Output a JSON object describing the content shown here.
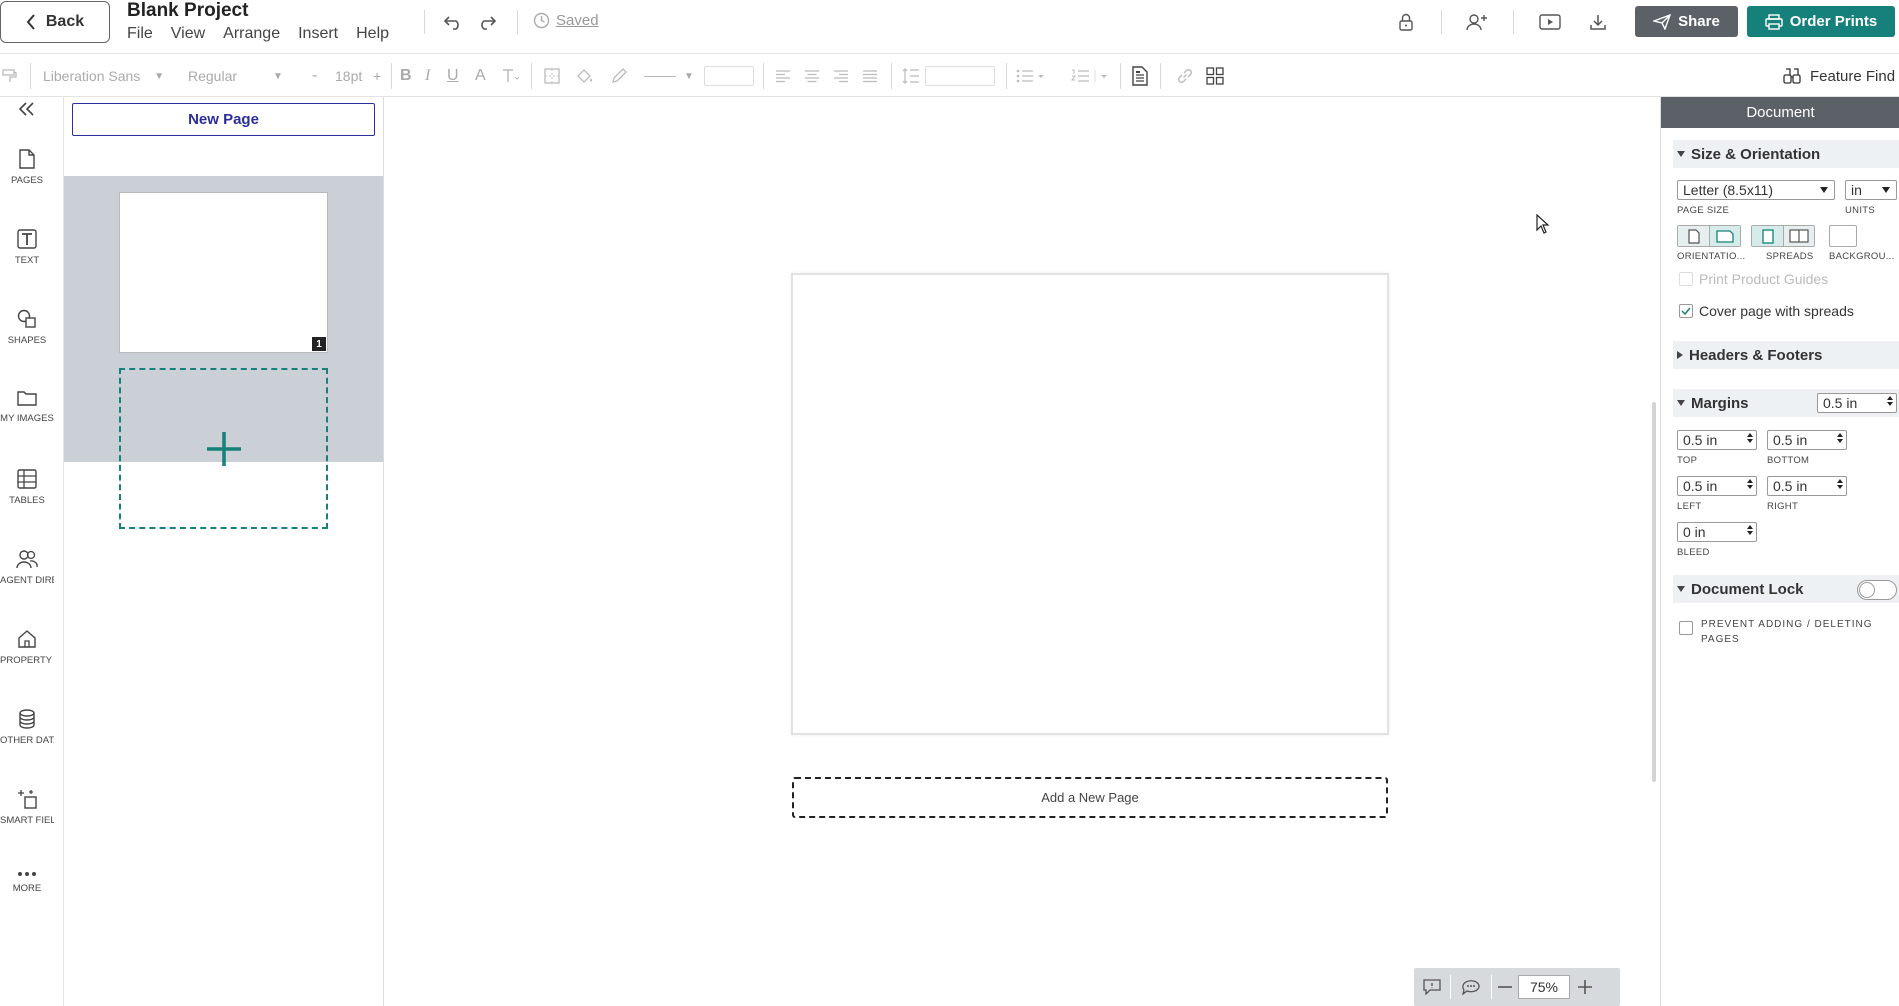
{
  "topbar": {
    "back_label": "Back",
    "project_title": "Blank Project",
    "menu": [
      "File",
      "View",
      "Arrange",
      "Insert",
      "Help"
    ],
    "saved_label": "Saved",
    "share_label": "Share",
    "order_prints_label": "Order Prints"
  },
  "format_toolbar": {
    "font_family": "Liberation Sans",
    "font_weight": "Regular",
    "font_size": "18pt",
    "bold": "B",
    "italic": "I",
    "underline": "U",
    "font_color": "A",
    "feature_find_label": "Feature Find"
  },
  "rail": [
    {
      "label": "PAGES",
      "icon": "page-icon"
    },
    {
      "label": "TEXT",
      "icon": "text-icon"
    },
    {
      "label": "SHAPES",
      "icon": "shapes-icon"
    },
    {
      "label": "MY IMAGES",
      "icon": "folder-icon"
    },
    {
      "label": "TABLES",
      "icon": "table-icon"
    },
    {
      "label": "AGENT DIRE...",
      "icon": "agents-icon"
    },
    {
      "label": "PROPERTY LI...",
      "icon": "house-icon"
    },
    {
      "label": "OTHER DATA",
      "icon": "database-icon"
    },
    {
      "label": "SMART FIEL...",
      "icon": "smart-field-icon"
    },
    {
      "label": "MORE",
      "icon": "more-icon"
    }
  ],
  "pages_panel": {
    "new_page_label": "New Page",
    "thumbnails": [
      {
        "number": "1"
      }
    ]
  },
  "canvas": {
    "add_page_label": "Add a New Page",
    "zoom": "75%"
  },
  "right_panel": {
    "header": "Document",
    "size_orientation": {
      "title": "Size & Orientation",
      "page_size": "Letter (8.5x11)",
      "page_size_label": "PAGE SIZE",
      "units": "in",
      "units_label": "UNITS",
      "orientation_label": "ORIENTATIO...",
      "spreads_label": "SPREADS",
      "background_label": "BACKGROU...",
      "print_guides_label": "Print Product Guides",
      "cover_spreads_label": "Cover page with spreads",
      "cover_spreads_checked": true
    },
    "headers_footers": {
      "title": "Headers & Footers"
    },
    "margins": {
      "title": "Margins",
      "all": "0.5 in",
      "top": "0.5 in",
      "top_label": "TOP",
      "bottom": "0.5 in",
      "bottom_label": "BOTTOM",
      "left": "0.5 in",
      "left_label": "LEFT",
      "right": "0.5 in",
      "right_label": "RIGHT",
      "bleed": "0 in",
      "bleed_label": "BLEED"
    },
    "document_lock": {
      "title": "Document Lock",
      "prevent_line1": "PREVENT ADDING / DELETING",
      "prevent_line2": "PAGES",
      "enabled": false
    }
  },
  "colors": {
    "accent_teal": "#16807a",
    "dark_gray": "#5b6166",
    "navy": "#2c2e9a"
  }
}
